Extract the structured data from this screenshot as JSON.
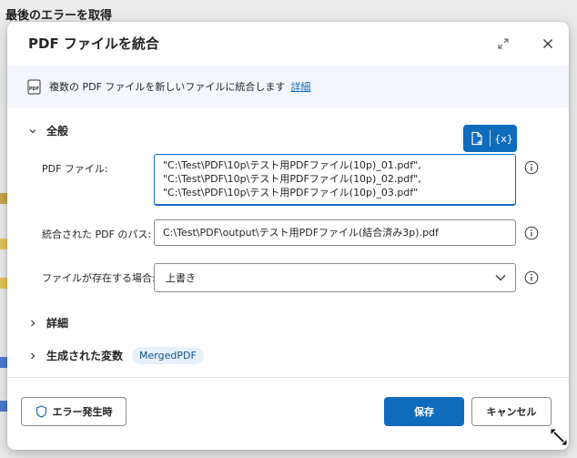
{
  "background": {
    "title": "最後のエラーを取得"
  },
  "dialog": {
    "title": "PDF ファイルを統合",
    "info_text": "複数の PDF ファイルを新しいファイルに統合します",
    "info_link": "詳細",
    "sections": {
      "general": "全般",
      "details": "詳細",
      "generated_vars": "生成された変数"
    },
    "fields": {
      "pdf_files_label": "PDF ファイル:",
      "pdf_files_value": "\"C:\\Test\\PDF\\10p\\テスト用PDFファイル(10p)_01.pdf\", \"C:\\Test\\PDF\\10p\\テスト用PDFファイル(10p)_02.pdf\", \"C:\\Test\\PDF\\10p\\テスト用PDFファイル(10p)_03.pdf\"",
      "merged_path_label": "統合された PDF のパス:",
      "merged_path_value": "C:\\Test\\PDF\\output\\テスト用PDFファイル(結合済み3p).pdf",
      "if_exists_label": "ファイルが存在する場合:",
      "if_exists_value": "上書き"
    },
    "variable_chip": "MergedPDF",
    "toolbar": {
      "file_icon": "file-picker-icon",
      "var_label": "{x}"
    },
    "buttons": {
      "on_error": "エラー発生時",
      "save": "保存",
      "cancel": "キャンセル"
    }
  },
  "colors": {
    "accent": "#0f6cbd",
    "info_bar": "#f3f6fc",
    "chip_bg": "#e8f0fb"
  }
}
